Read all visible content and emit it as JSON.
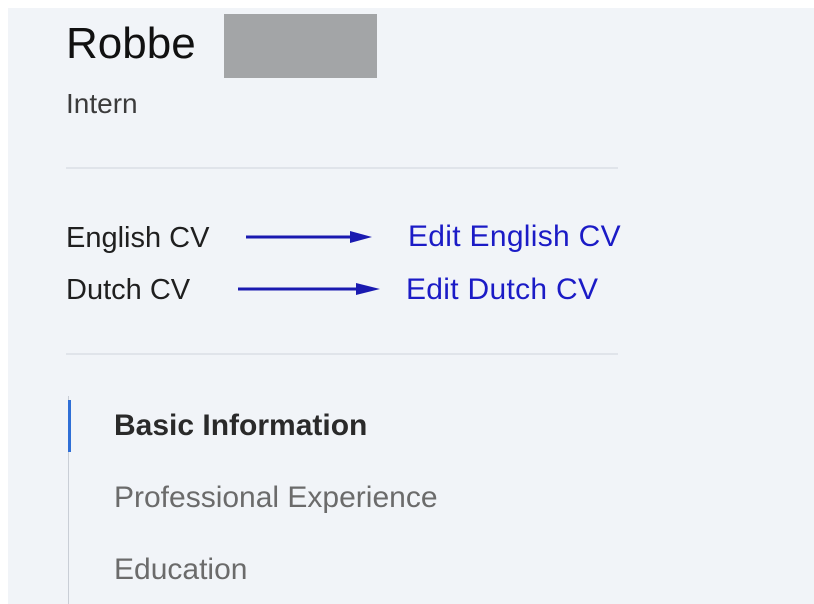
{
  "profile": {
    "first_name": "Robbe",
    "role": "Intern"
  },
  "cv_links": [
    {
      "label": "English CV",
      "edit_label": "Edit English CV"
    },
    {
      "label": "Dutch CV",
      "edit_label": "Edit Dutch CV"
    }
  ],
  "nav": {
    "items": [
      {
        "label": "Basic Information",
        "active": true
      },
      {
        "label": "Professional Experience",
        "active": false
      },
      {
        "label": "Education",
        "active": false
      }
    ]
  },
  "colors": {
    "panel_background": "#f1f4f8",
    "link": "#1b1bc6",
    "annotation_arrow": "#1a1ab0",
    "active_indicator": "#2f6fd6",
    "redaction": "#a3a5a7"
  },
  "icons": {
    "annotation_arrow": "right-arrow-icon"
  }
}
